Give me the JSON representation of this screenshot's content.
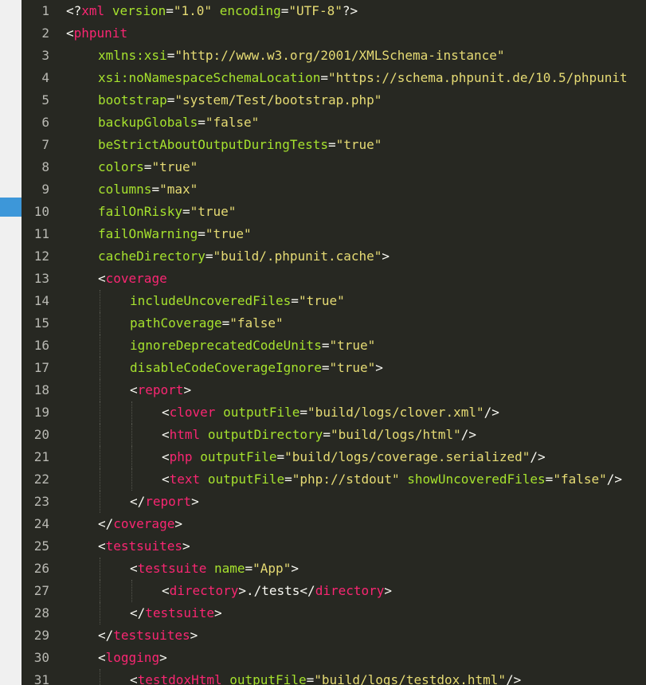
{
  "editor": {
    "lines": [
      {
        "n": "1",
        "indent": 0,
        "tokens": [
          {
            "t": "punc",
            "v": "<?"
          },
          {
            "t": "tag",
            "v": "xml"
          },
          {
            "t": "text",
            "v": " "
          },
          {
            "t": "attr",
            "v": "version"
          },
          {
            "t": "punc",
            "v": "="
          },
          {
            "t": "str",
            "v": "\"1.0\""
          },
          {
            "t": "text",
            "v": " "
          },
          {
            "t": "attr",
            "v": "encoding"
          },
          {
            "t": "punc",
            "v": "="
          },
          {
            "t": "str",
            "v": "\"UTF-8\""
          },
          {
            "t": "punc",
            "v": "?>"
          }
        ]
      },
      {
        "n": "2",
        "indent": 0,
        "tokens": [
          {
            "t": "punc",
            "v": "<"
          },
          {
            "t": "tag",
            "v": "phpunit"
          }
        ]
      },
      {
        "n": "3",
        "indent": 1,
        "tokens": [
          {
            "t": "attr",
            "v": "xmlns:xsi"
          },
          {
            "t": "punc",
            "v": "="
          },
          {
            "t": "str",
            "v": "\"http://www.w3.org/2001/XMLSchema-instance\""
          }
        ]
      },
      {
        "n": "4",
        "indent": 1,
        "tokens": [
          {
            "t": "attr",
            "v": "xsi:noNamespaceSchemaLocation"
          },
          {
            "t": "punc",
            "v": "="
          },
          {
            "t": "str",
            "v": "\"https://schema.phpunit.de/10.5/phpunit"
          }
        ]
      },
      {
        "n": "5",
        "indent": 1,
        "tokens": [
          {
            "t": "attr",
            "v": "bootstrap"
          },
          {
            "t": "punc",
            "v": "="
          },
          {
            "t": "str",
            "v": "\"system/Test/bootstrap.php\""
          }
        ]
      },
      {
        "n": "6",
        "indent": 1,
        "tokens": [
          {
            "t": "attr",
            "v": "backupGlobals"
          },
          {
            "t": "punc",
            "v": "="
          },
          {
            "t": "str",
            "v": "\"false\""
          }
        ]
      },
      {
        "n": "7",
        "indent": 1,
        "tokens": [
          {
            "t": "attr",
            "v": "beStrictAboutOutputDuringTests"
          },
          {
            "t": "punc",
            "v": "="
          },
          {
            "t": "str",
            "v": "\"true\""
          }
        ]
      },
      {
        "n": "8",
        "indent": 1,
        "tokens": [
          {
            "t": "attr",
            "v": "colors"
          },
          {
            "t": "punc",
            "v": "="
          },
          {
            "t": "str",
            "v": "\"true\""
          }
        ]
      },
      {
        "n": "9",
        "indent": 1,
        "tokens": [
          {
            "t": "attr",
            "v": "columns"
          },
          {
            "t": "punc",
            "v": "="
          },
          {
            "t": "str",
            "v": "\"max\""
          }
        ]
      },
      {
        "n": "10",
        "indent": 1,
        "tokens": [
          {
            "t": "attr",
            "v": "failOnRisky"
          },
          {
            "t": "punc",
            "v": "="
          },
          {
            "t": "str",
            "v": "\"true\""
          }
        ]
      },
      {
        "n": "11",
        "indent": 1,
        "tokens": [
          {
            "t": "attr",
            "v": "failOnWarning"
          },
          {
            "t": "punc",
            "v": "="
          },
          {
            "t": "str",
            "v": "\"true\""
          }
        ]
      },
      {
        "n": "12",
        "indent": 1,
        "tokens": [
          {
            "t": "attr",
            "v": "cacheDirectory"
          },
          {
            "t": "punc",
            "v": "="
          },
          {
            "t": "str",
            "v": "\"build/.phpunit.cache\""
          },
          {
            "t": "punc",
            "v": ">"
          }
        ]
      },
      {
        "n": "13",
        "indent": 1,
        "tokens": [
          {
            "t": "punc",
            "v": "<"
          },
          {
            "t": "tag",
            "v": "coverage"
          }
        ]
      },
      {
        "n": "14",
        "indent": 2,
        "tokens": [
          {
            "t": "attr",
            "v": "includeUncoveredFiles"
          },
          {
            "t": "punc",
            "v": "="
          },
          {
            "t": "str",
            "v": "\"true\""
          }
        ]
      },
      {
        "n": "15",
        "indent": 2,
        "tokens": [
          {
            "t": "attr",
            "v": "pathCoverage"
          },
          {
            "t": "punc",
            "v": "="
          },
          {
            "t": "str",
            "v": "\"false\""
          }
        ]
      },
      {
        "n": "16",
        "indent": 2,
        "tokens": [
          {
            "t": "attr",
            "v": "ignoreDeprecatedCodeUnits"
          },
          {
            "t": "punc",
            "v": "="
          },
          {
            "t": "str",
            "v": "\"true\""
          }
        ]
      },
      {
        "n": "17",
        "indent": 2,
        "tokens": [
          {
            "t": "attr",
            "v": "disableCodeCoverageIgnore"
          },
          {
            "t": "punc",
            "v": "="
          },
          {
            "t": "str",
            "v": "\"true\""
          },
          {
            "t": "punc",
            "v": ">"
          }
        ]
      },
      {
        "n": "18",
        "indent": 2,
        "tokens": [
          {
            "t": "punc",
            "v": "<"
          },
          {
            "t": "tag",
            "v": "report"
          },
          {
            "t": "punc",
            "v": ">"
          }
        ]
      },
      {
        "n": "19",
        "indent": 3,
        "tokens": [
          {
            "t": "punc",
            "v": "<"
          },
          {
            "t": "tag",
            "v": "clover"
          },
          {
            "t": "text",
            "v": " "
          },
          {
            "t": "attr",
            "v": "outputFile"
          },
          {
            "t": "punc",
            "v": "="
          },
          {
            "t": "str",
            "v": "\"build/logs/clover.xml\""
          },
          {
            "t": "punc",
            "v": "/>"
          }
        ]
      },
      {
        "n": "20",
        "indent": 3,
        "tokens": [
          {
            "t": "punc",
            "v": "<"
          },
          {
            "t": "tag",
            "v": "html"
          },
          {
            "t": "text",
            "v": " "
          },
          {
            "t": "attr",
            "v": "outputDirectory"
          },
          {
            "t": "punc",
            "v": "="
          },
          {
            "t": "str",
            "v": "\"build/logs/html\""
          },
          {
            "t": "punc",
            "v": "/>"
          }
        ]
      },
      {
        "n": "21",
        "indent": 3,
        "tokens": [
          {
            "t": "punc",
            "v": "<"
          },
          {
            "t": "tag",
            "v": "php"
          },
          {
            "t": "text",
            "v": " "
          },
          {
            "t": "attr",
            "v": "outputFile"
          },
          {
            "t": "punc",
            "v": "="
          },
          {
            "t": "str",
            "v": "\"build/logs/coverage.serialized\""
          },
          {
            "t": "punc",
            "v": "/>"
          }
        ]
      },
      {
        "n": "22",
        "indent": 3,
        "tokens": [
          {
            "t": "punc",
            "v": "<"
          },
          {
            "t": "tag",
            "v": "text"
          },
          {
            "t": "text",
            "v": " "
          },
          {
            "t": "attr",
            "v": "outputFile"
          },
          {
            "t": "punc",
            "v": "="
          },
          {
            "t": "str",
            "v": "\"php://stdout\""
          },
          {
            "t": "text",
            "v": " "
          },
          {
            "t": "attr",
            "v": "showUncoveredFiles"
          },
          {
            "t": "punc",
            "v": "="
          },
          {
            "t": "str",
            "v": "\"false\""
          },
          {
            "t": "punc",
            "v": "/>"
          }
        ]
      },
      {
        "n": "23",
        "indent": 2,
        "tokens": [
          {
            "t": "punc",
            "v": "</"
          },
          {
            "t": "tag",
            "v": "report"
          },
          {
            "t": "punc",
            "v": ">"
          }
        ]
      },
      {
        "n": "24",
        "indent": 1,
        "tokens": [
          {
            "t": "punc",
            "v": "</"
          },
          {
            "t": "tag",
            "v": "coverage"
          },
          {
            "t": "punc",
            "v": ">"
          }
        ]
      },
      {
        "n": "25",
        "indent": 1,
        "tokens": [
          {
            "t": "punc",
            "v": "<"
          },
          {
            "t": "tag",
            "v": "testsuites"
          },
          {
            "t": "punc",
            "v": ">"
          }
        ]
      },
      {
        "n": "26",
        "indent": 2,
        "tokens": [
          {
            "t": "punc",
            "v": "<"
          },
          {
            "t": "tag",
            "v": "testsuite"
          },
          {
            "t": "text",
            "v": " "
          },
          {
            "t": "attr",
            "v": "name"
          },
          {
            "t": "punc",
            "v": "="
          },
          {
            "t": "str",
            "v": "\"App\""
          },
          {
            "t": "punc",
            "v": ">"
          }
        ]
      },
      {
        "n": "27",
        "indent": 3,
        "tokens": [
          {
            "t": "punc",
            "v": "<"
          },
          {
            "t": "tag",
            "v": "directory"
          },
          {
            "t": "punc",
            "v": ">"
          },
          {
            "t": "text",
            "v": "./tests"
          },
          {
            "t": "punc",
            "v": "</"
          },
          {
            "t": "tag",
            "v": "directory"
          },
          {
            "t": "punc",
            "v": ">"
          }
        ]
      },
      {
        "n": "28",
        "indent": 2,
        "tokens": [
          {
            "t": "punc",
            "v": "</"
          },
          {
            "t": "tag",
            "v": "testsuite"
          },
          {
            "t": "punc",
            "v": ">"
          }
        ]
      },
      {
        "n": "29",
        "indent": 1,
        "tokens": [
          {
            "t": "punc",
            "v": "</"
          },
          {
            "t": "tag",
            "v": "testsuites"
          },
          {
            "t": "punc",
            "v": ">"
          }
        ]
      },
      {
        "n": "30",
        "indent": 1,
        "tokens": [
          {
            "t": "punc",
            "v": "<"
          },
          {
            "t": "tag",
            "v": "logging"
          },
          {
            "t": "punc",
            "v": ">"
          }
        ]
      },
      {
        "n": "31",
        "indent": 2,
        "tokens": [
          {
            "t": "punc",
            "v": "<"
          },
          {
            "t": "tag",
            "v": "testdoxHtml"
          },
          {
            "t": "text",
            "v": " "
          },
          {
            "t": "attr",
            "v": "outputFile"
          },
          {
            "t": "punc",
            "v": "="
          },
          {
            "t": "str",
            "v": "\"build/logs/testdox.html\""
          },
          {
            "t": "punc",
            "v": "/>"
          }
        ]
      }
    ]
  },
  "colors": {
    "background": "#272822",
    "tag": "#f92672",
    "attribute": "#a6e22e",
    "string": "#e6db74",
    "text": "#f8f8f2",
    "line_number": "#b9b9b3",
    "left_marker": "#3d97d9"
  }
}
